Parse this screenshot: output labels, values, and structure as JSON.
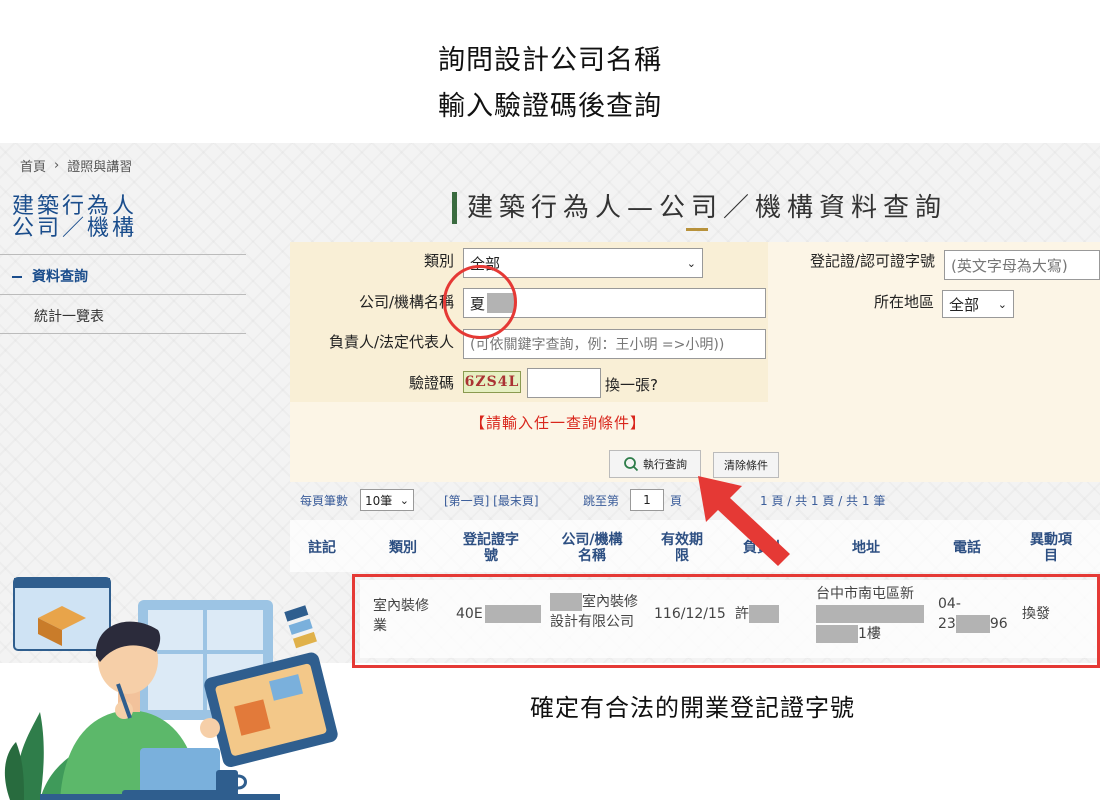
{
  "captions": {
    "line1": "詢問設計公司名稱",
    "line2": "輸入驗證碼後查詢",
    "bottom": "確定有合法的開業登記證字號"
  },
  "breadcrumb": {
    "home": "首頁",
    "separator": "›",
    "current": "證照與講習"
  },
  "sidebar": {
    "title_line1": "建築行為人",
    "title_line2": "公司／機構",
    "items": [
      {
        "label": "資料查詢",
        "active": true
      },
      {
        "label": "統計一覽表",
        "active": false
      }
    ]
  },
  "page_title": "建築行為人—公司／機構資料查詢",
  "form": {
    "category_label": "類別",
    "category_value": "全部",
    "license_label": "登記證/認可證字號",
    "license_placeholder": "(英文字母為大寫)",
    "company_label": "公司/機構名稱",
    "company_value": "夏",
    "region_label": "所在地區",
    "region_value": "全部",
    "owner_label": "負責人/法定代表人",
    "owner_placeholder": "(可依關鍵字查詢，例：王小明 =>小明))",
    "captcha_label": "驗證碼",
    "captcha_code": "6ZS4L",
    "captcha_refresh": "換一張?",
    "warning": "【請輸入任一查詢條件】",
    "search_button": "執行查詢",
    "clear_button": "清除條件"
  },
  "paging": {
    "per_page_label": "每頁筆數",
    "per_page_value": "10筆",
    "first_last": "[第一頁] [最末頁]",
    "jump_label": "跳至第",
    "jump_value": "1",
    "jump_unit": "頁",
    "summary": "1 頁 / 共 1 頁 / 共 1 筆"
  },
  "table": {
    "headers": {
      "note": "註記",
      "type": "類別",
      "license_l1": "登記證字",
      "license_l2": "號",
      "name_l1": "公司/機構",
      "name_l2": "名稱",
      "expiry_l1": "有效期",
      "expiry_l2": "限",
      "owner": "負責人",
      "address": "地址",
      "phone": "電話",
      "change_l1": "異動項",
      "change_l2": "目"
    },
    "row": {
      "type_l1": "室內裝修",
      "type_l2": "業",
      "license": "40E",
      "name_l1": "室內裝修",
      "name_l2": "設計有限公司",
      "expiry": "116/12/15",
      "owner": "許",
      "address_l1": "台中市南屯區新",
      "address_l3": "1樓",
      "phone_l1": "04-",
      "phone_l2a": "23",
      "phone_l2b": "96",
      "change": "換發"
    }
  },
  "colors": {
    "highlight": "#e53935",
    "accent_blue": "#1a4d8c",
    "form_bg": "#fcf5e6"
  }
}
